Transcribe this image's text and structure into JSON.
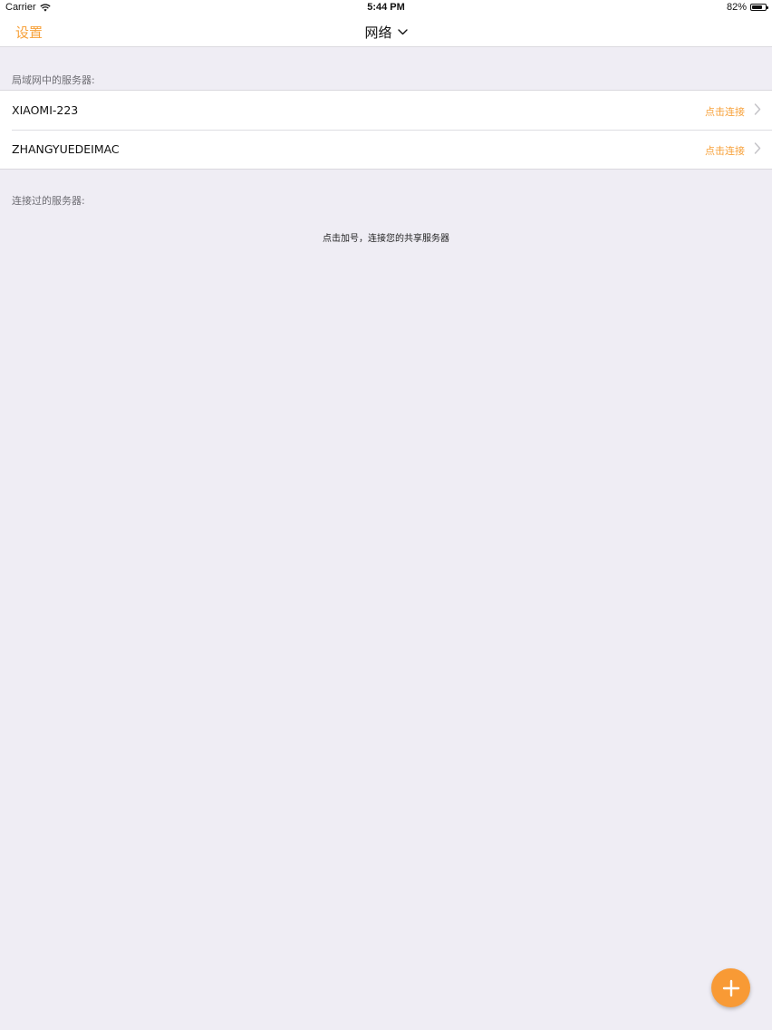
{
  "status_bar": {
    "carrier": "Carrier",
    "time": "5:44 PM",
    "battery_text": "82%",
    "battery_level": 0.82,
    "icons": [
      "wifi-icon",
      "battery-icon"
    ]
  },
  "nav": {
    "settings_label": "设置",
    "title": "网络",
    "title_icon": "chevron-down-icon"
  },
  "lan_section": {
    "header": "局域网中的服务器:",
    "servers": [
      {
        "name": "XIAOMI-223",
        "action": "点击连接"
      },
      {
        "name": "ZHANGYUEDEIMAC",
        "action": "点击连接"
      }
    ]
  },
  "history_section": {
    "header": "连接过的服务器:",
    "empty_hint": "点击加号，连接您的共享服务器"
  },
  "fab": {
    "icon": "plus-icon"
  },
  "colors": {
    "accent": "#f7a13a",
    "background": "#efedf4",
    "fab": "#f89a35"
  }
}
